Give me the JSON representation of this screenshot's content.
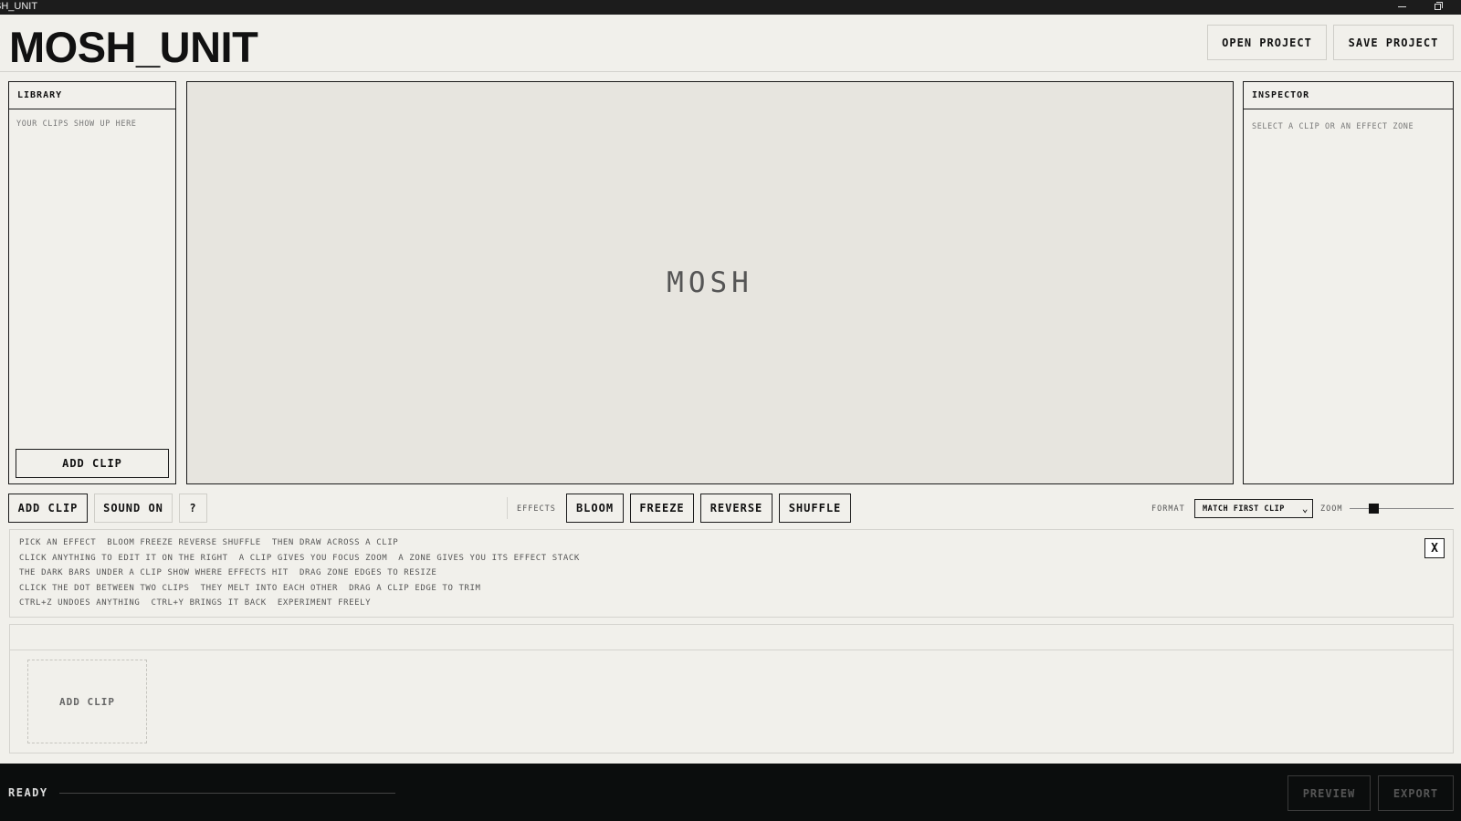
{
  "window": {
    "title": "SH_UNIT"
  },
  "header": {
    "logo": "MOSH_UNIT",
    "open_project": "OPEN PROJECT",
    "save_project": "SAVE PROJECT"
  },
  "library": {
    "title": "LIBRARY",
    "empty_hint": "YOUR CLIPS SHOW UP HERE",
    "add_clip": "ADD CLIP"
  },
  "preview": {
    "placeholder": "MOSH"
  },
  "inspector": {
    "title": "INSPECTOR",
    "hint": "SELECT A CLIP OR AN EFFECT ZONE"
  },
  "toolbar": {
    "add_clip": "ADD CLIP",
    "sound": "SOUND ON",
    "help": "?",
    "effects_label": "EFFECTS",
    "effects": [
      "BLOOM",
      "FREEZE",
      "REVERSE",
      "SHUFFLE"
    ],
    "format_label": "FORMAT",
    "format_value": "MATCH FIRST CLIP",
    "zoom_label": "ZOOM",
    "zoom_level": 0.2
  },
  "tips": {
    "lines": [
      "PICK AN EFFECT  BLOOM FREEZE REVERSE SHUFFLE  THEN DRAW ACROSS A CLIP",
      "CLICK ANYTHING TO EDIT IT ON THE RIGHT  A CLIP GIVES YOU FOCUS ZOOM  A ZONE GIVES YOU ITS EFFECT STACK",
      "THE DARK BARS UNDER A CLIP SHOW WHERE EFFECTS HIT  DRAG ZONE EDGES TO RESIZE",
      "CLICK THE DOT BETWEEN TWO CLIPS  THEY MELT INTO EACH OTHER  DRAG A CLIP EDGE TO TRIM",
      "CTRL+Z UNDOES ANYTHING  CTRL+Y BRINGS IT BACK  EXPERIMENT FREELY"
    ],
    "close": "X"
  },
  "timeline": {
    "add_clip": "ADD CLIP"
  },
  "footer": {
    "status": "READY",
    "progress": 0,
    "preview": "PREVIEW",
    "export": "EXPORT"
  }
}
